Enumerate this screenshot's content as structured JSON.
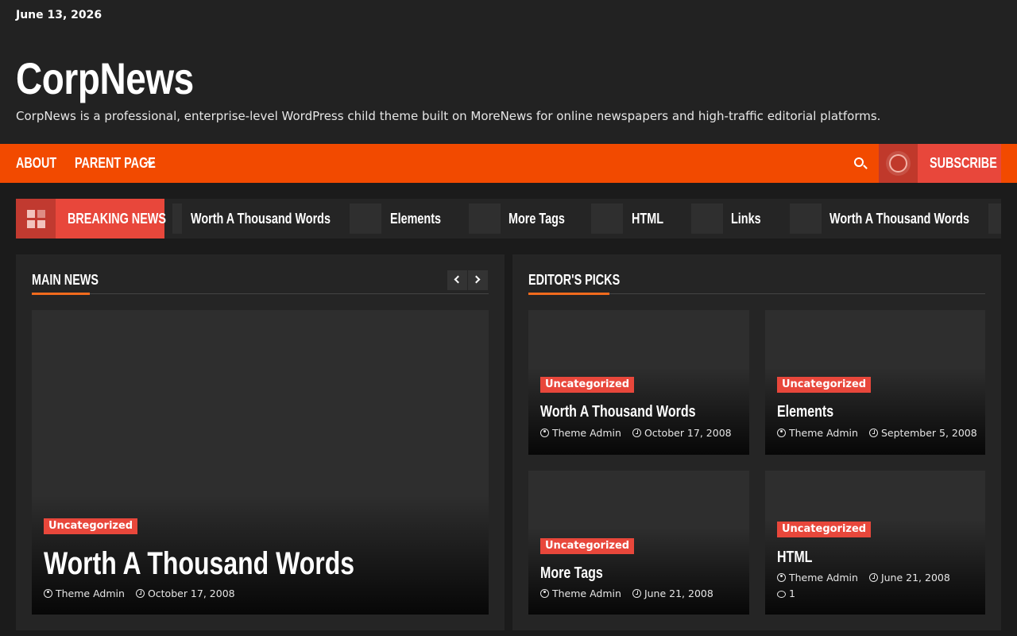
{
  "header": {
    "date": "June 13, 2026",
    "site_title": "CorpNews",
    "tagline": "CorpNews is a professional, enterprise-level WordPress child theme built on MoreNews for online newspapers and high-traffic editorial platforms."
  },
  "nav": {
    "items": [
      {
        "label": "ABOUT"
      },
      {
        "label": "PARENT PAGE"
      }
    ],
    "subscribe_label": "SUBSCRIBE"
  },
  "ticker": {
    "label": "BREAKING NEWS",
    "items": [
      {
        "title": "Worth A Thousand Words"
      },
      {
        "title": "Elements"
      },
      {
        "title": "More Tags"
      },
      {
        "title": "HTML"
      },
      {
        "title": "Links"
      },
      {
        "title": "Worth A Thousand Words"
      }
    ]
  },
  "main_news": {
    "title": "MAIN NEWS",
    "featured": {
      "category": "Uncategorized",
      "title": "Worth A Thousand Words",
      "author": "Theme Admin",
      "date": "October 17, 2008"
    }
  },
  "editors_picks": {
    "title": "EDITOR'S PICKS",
    "cards": [
      {
        "category": "Uncategorized",
        "title": "Worth A Thousand Words",
        "author": "Theme Admin",
        "date": "October 17, 2008"
      },
      {
        "category": "Uncategorized",
        "title": "Elements",
        "author": "Theme Admin",
        "date": "September 5, 2008"
      },
      {
        "category": "Uncategorized",
        "title": "More Tags",
        "author": "Theme Admin",
        "date": "June 21, 2008"
      },
      {
        "category": "Uncategorized",
        "title": "HTML",
        "author": "Theme Admin",
        "date": "June 21, 2008",
        "comments": "1"
      }
    ]
  },
  "colors": {
    "nav_bg": "#f24a00",
    "accent_red": "#e8473b",
    "accent_orange": "#f26b1d",
    "page_bg": "#1b1b1b",
    "header_bg": "#222222"
  },
  "icons": {
    "search": "search-icon",
    "live": "live-circle-icon",
    "grid": "grid-icon",
    "author": "user-icon",
    "date": "clock-icon",
    "comments": "comment-icon"
  }
}
